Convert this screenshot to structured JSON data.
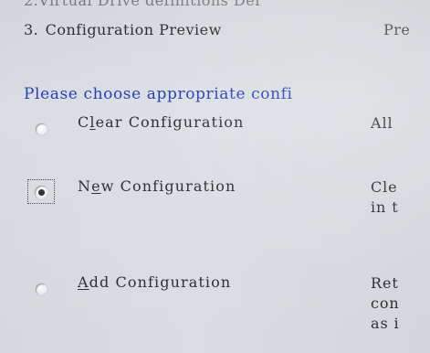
{
  "steps": {
    "item_1": "2.Virtual Drive definitions  Def",
    "item_3": {
      "number": "3.",
      "label": "Configuration Preview",
      "desc_prefix": "Pre"
    }
  },
  "prompt": "Please choose appropriate confi",
  "options": [
    {
      "id": "clear",
      "label_pre": "C",
      "label_mnemonic": "l",
      "label_post": "ear Configuration",
      "description": "All",
      "selected": false
    },
    {
      "id": "new",
      "label_pre": "N",
      "label_mnemonic": "e",
      "label_post": "w Configuration",
      "description": "Cle\nin t",
      "selected": true
    },
    {
      "id": "add",
      "label_pre": "",
      "label_mnemonic": "A",
      "label_post": "dd Configuration",
      "description": "Ret\ncon\nas i",
      "selected": false
    }
  ],
  "colors": {
    "prompt_text": "#2a3fb8",
    "background": "#d7dbdf",
    "text": "#2f3135"
  }
}
